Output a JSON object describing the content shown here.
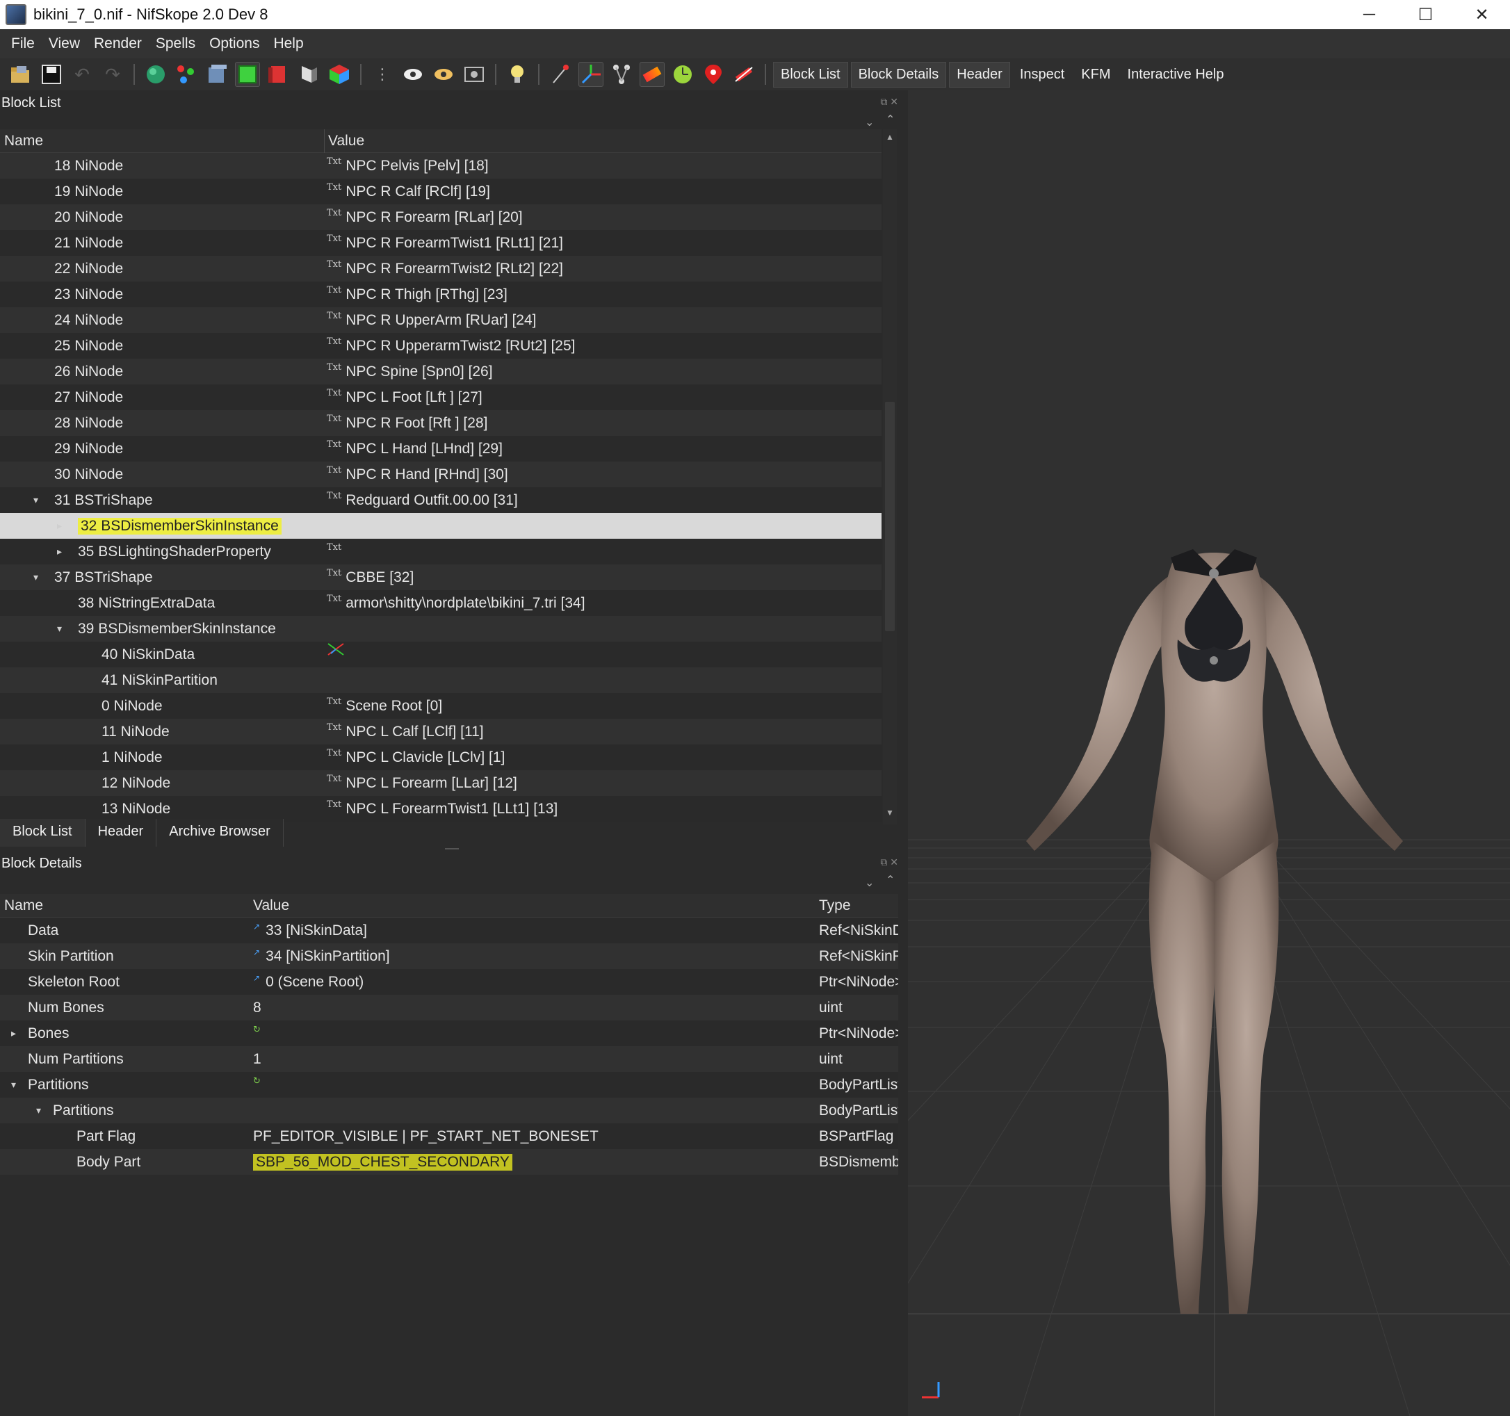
{
  "window": {
    "title": "bikini_7_0.nif - NifSkope 2.0 Dev 8",
    "minimize": "─",
    "maximize": "☐",
    "close": "✕"
  },
  "menu": [
    "File",
    "View",
    "Render",
    "Spells",
    "Options",
    "Help"
  ],
  "toolbar": {
    "toggles": [
      "Block List",
      "Block Details",
      "Header",
      "Inspect",
      "KFM",
      "Interactive Help"
    ]
  },
  "block_list": {
    "title": "Block List",
    "columns": {
      "name": "Name",
      "value": "Value"
    },
    "rows": [
      {
        "name": "18 NiNode",
        "value": "NPC Pelvis [Pelv] [18]",
        "icon": "txt"
      },
      {
        "name": "19 NiNode",
        "value": "NPC R Calf [RClf] [19]",
        "icon": "txt"
      },
      {
        "name": "20 NiNode",
        "value": "NPC R Forearm [RLar] [20]",
        "icon": "txt"
      },
      {
        "name": "21 NiNode",
        "value": "NPC R ForearmTwist1 [RLt1] [21]",
        "icon": "txt"
      },
      {
        "name": "22 NiNode",
        "value": "NPC R ForearmTwist2 [RLt2] [22]",
        "icon": "txt"
      },
      {
        "name": "23 NiNode",
        "value": "NPC R Thigh [RThg] [23]",
        "icon": "txt"
      },
      {
        "name": "24 NiNode",
        "value": "NPC R UpperArm [RUar] [24]",
        "icon": "txt"
      },
      {
        "name": "25 NiNode",
        "value": "NPC R UpperarmTwist2 [RUt2] [25]",
        "icon": "txt"
      },
      {
        "name": "26 NiNode",
        "value": "NPC Spine [Spn0] [26]",
        "icon": "txt"
      },
      {
        "name": "27 NiNode",
        "value": "NPC L Foot [Lft ] [27]",
        "icon": "txt"
      },
      {
        "name": "28 NiNode",
        "value": "NPC R Foot [Rft ] [28]",
        "icon": "txt"
      },
      {
        "name": "29 NiNode",
        "value": "NPC L Hand [LHnd] [29]",
        "icon": "txt"
      },
      {
        "name": "30 NiNode",
        "value": "NPC R Hand [RHnd] [30]",
        "icon": "txt"
      },
      {
        "name": "31 BSTriShape",
        "value": "Redguard Outfit.00.00 [31]",
        "icon": "txt",
        "expander": "open"
      },
      {
        "name": "32 BSDismemberSkinInstance",
        "value": "",
        "icon": "",
        "expander": "closed",
        "selected": true
      },
      {
        "name": "35 BSLightingShaderProperty",
        "value": "",
        "icon": "txt",
        "expander": "closed"
      },
      {
        "name": "37 BSTriShape",
        "value": "CBBE [32]",
        "icon": "txt",
        "expander": "open"
      },
      {
        "name": "38 NiStringExtraData",
        "value": "armor\\shitty\\nordplate\\bikini_7.tri [34]",
        "icon": "txt"
      },
      {
        "name": "39 BSDismemberSkinInstance",
        "value": "",
        "icon": "",
        "expander": "open"
      },
      {
        "name": "40 NiSkinData",
        "value": "",
        "icon": "axes"
      },
      {
        "name": "41 NiSkinPartition",
        "value": "",
        "icon": ""
      },
      {
        "name": "0 NiNode",
        "value": "Scene Root [0]",
        "icon": "txt"
      },
      {
        "name": "11 NiNode",
        "value": "NPC L Calf [LClf] [11]",
        "icon": "txt"
      },
      {
        "name": "1 NiNode",
        "value": "NPC L Clavicle [LClv] [1]",
        "icon": "txt"
      },
      {
        "name": "12 NiNode",
        "value": "NPC L Forearm [LLar] [12]",
        "icon": "txt"
      },
      {
        "name": "13 NiNode",
        "value": "NPC L ForearmTwist1 [LLt1] [13]",
        "icon": "txt"
      }
    ]
  },
  "tabs": [
    "Block List",
    "Header",
    "Archive Browser"
  ],
  "block_details": {
    "title": "Block Details",
    "columns": {
      "name": "Name",
      "value": "Value",
      "type": "Type"
    },
    "rows": [
      {
        "name": "Data",
        "value": "33 [NiSkinData]",
        "type": "Ref<NiSkinData>",
        "icon": "ref"
      },
      {
        "name": "Skin Partition",
        "value": "34 [NiSkinPartition]",
        "type": "Ref<NiSkinPartition>",
        "icon": "ref"
      },
      {
        "name": "Skeleton Root",
        "value": "0 (Scene Root)",
        "type": "Ptr<NiNode>",
        "icon": "ref"
      },
      {
        "name": "Num Bones",
        "value": "8",
        "type": "uint",
        "icon": ""
      },
      {
        "name": "Bones",
        "value": "",
        "type": "Ptr<NiNode>",
        "icon": "array",
        "expander": "closed"
      },
      {
        "name": "Num Partitions",
        "value": "1",
        "type": "uint",
        "icon": ""
      },
      {
        "name": "Partitions",
        "value": "",
        "type": "BodyPartList",
        "icon": "array",
        "expander": "open"
      },
      {
        "name": "Partitions",
        "value": "",
        "type": "BodyPartList",
        "icon": "",
        "expander": "open"
      },
      {
        "name": "Part Flag",
        "value": "PF_EDITOR_VISIBLE | PF_START_NET_BONESET",
        "type": "BSPartFlag",
        "icon": ""
      },
      {
        "name": "Body Part",
        "value": "SBP_56_MOD_CHEST_SECONDARY",
        "type": "BSDismemberBodyPartType",
        "icon": "",
        "highlight": true
      }
    ]
  },
  "colors": {
    "background": "#2b2b2b",
    "selected_row": "#d9d9d9",
    "highlight": "#f0f028"
  }
}
